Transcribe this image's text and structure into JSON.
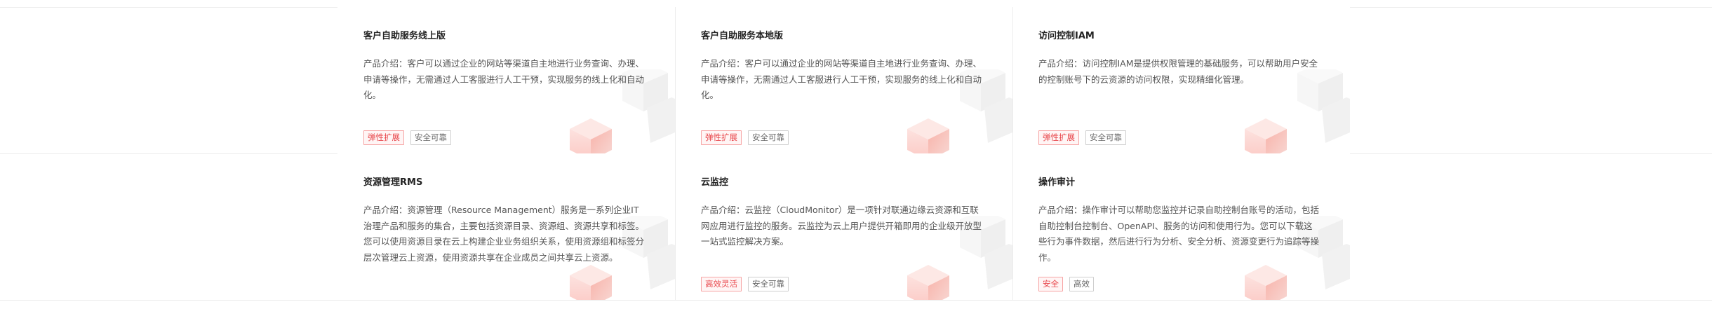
{
  "cards": [
    {
      "title": "客户自助服务线上版",
      "description": "产品介绍：客户可以通过企业的网站等渠道自主地进行业务查询、办理、申请等操作，无需通过人工客服进行人工干预，实现服务的线上化和自动化。",
      "tags": [
        "弹性扩展",
        "安全可靠"
      ]
    },
    {
      "title": "客户自助服务本地版",
      "description": "产品介绍：客户可以通过企业的网站等渠道自主地进行业务查询、办理、申请等操作，无需通过人工客服进行人工干预，实现服务的线上化和自动化。",
      "tags": [
        "弹性扩展",
        "安全可靠"
      ]
    },
    {
      "title": "访问控制IAM",
      "description": "产品介绍：访问控制IAM是提供权限管理的基础服务，可以帮助用户安全的控制账号下的云资源的访问权限，实现精细化管理。",
      "tags": [
        "弹性扩展",
        "安全可靠"
      ]
    },
    {
      "title": "资源管理RMS",
      "description": "产品介绍：资源管理（Resource Management）服务是一系列企业IT治理产品和服务的集合，主要包括资源目录、资源组、资源共享和标签。您可以使用资源目录在云上构建企业业务组织关系，使用资源组和标签分层次管理云上资源，使用资源共享在企业成员之间共享云上资源。",
      "tags": []
    },
    {
      "title": "云监控",
      "description": "产品介绍：云监控（CloudMonitor）是一项针对联通边缘云资源和互联网应用进行监控的服务。云监控为云上用户提供开箱即用的企业级开放型一站式监控解决方案。",
      "tags": [
        "高效灵活",
        "安全可靠"
      ]
    },
    {
      "title": "操作审计",
      "description": "产品介绍：操作审计可以帮助您监控并记录自助控制台账号的活动，包括自助控制台控制台、OpenAPI、服务的访问和使用行为。您可以下载这些行为事件数据，然后进行行为分析、安全分析、资源变更行为追踪等操作。",
      "tags": [
        "安全",
        "高效"
      ]
    }
  ],
  "colors": {
    "tag_hot_border": "#f7a4a4",
    "tag_hot_text": "#e8474c",
    "tag_plain_border": "#cfcfcf",
    "divider": "#ececec"
  }
}
